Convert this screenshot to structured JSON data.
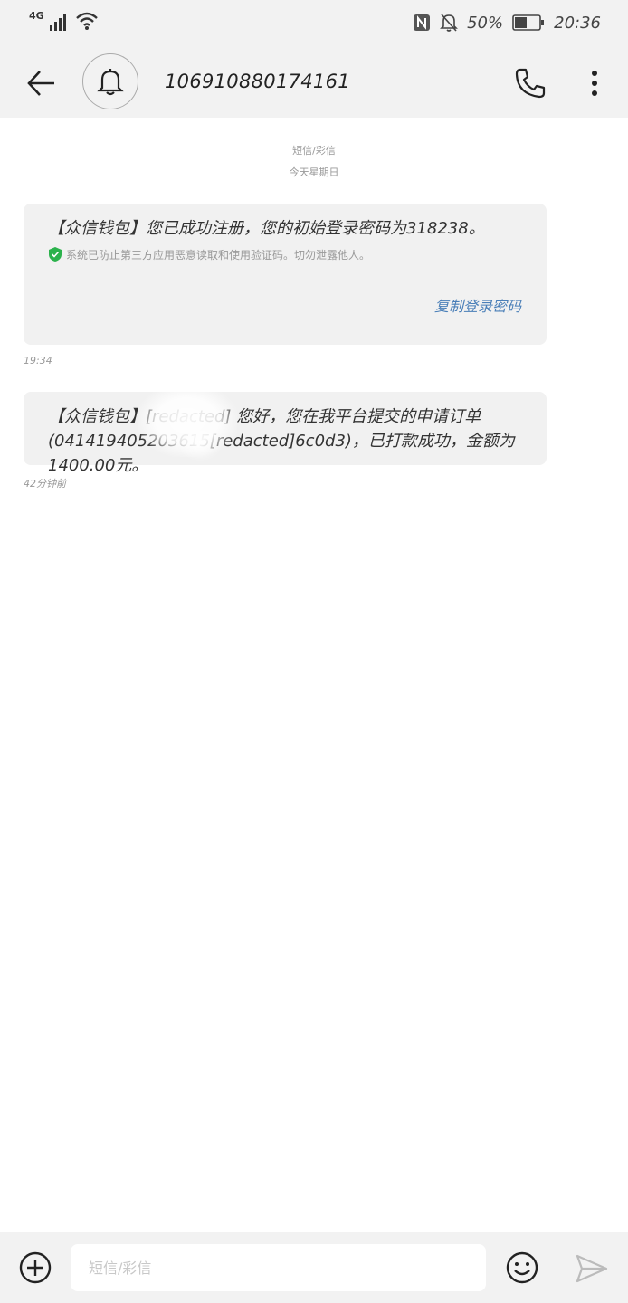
{
  "status_bar": {
    "network": "4G",
    "battery_percent": "50%",
    "battery_level": 0.5,
    "time": "20:36",
    "icons": [
      "signal-icon",
      "wifi-icon",
      "nfc-icon",
      "mute-icon",
      "battery-icon"
    ]
  },
  "toolbar": {
    "contact_number": "106910880174161",
    "icons": [
      "back-arrow-icon",
      "bell-icon",
      "phone-icon",
      "more-vertical-icon"
    ]
  },
  "conversation": {
    "type_label": "短信/彩信",
    "day_label": "今天星期日"
  },
  "messages": [
    {
      "text": "【众信钱包】您已成功注册，您的初始登录密码为318238。",
      "security_note": "系统已防止第三方应用恶意读取和使用验证码。切勿泄露他人。",
      "action_label": "复制登录密码",
      "timestamp": "19:34"
    },
    {
      "text": "【众信钱包】[redacted] 您好，您在我平台提交的申请订单(041419405203615[redacted]6c0d3)，已打款成功，金额为1400.00元。",
      "timestamp": "42分钟前"
    }
  ],
  "composer": {
    "placeholder": "短信/彩信",
    "icons": [
      "add-circle-icon",
      "emoji-icon",
      "send-icon"
    ]
  },
  "colors": {
    "bar_background": "#f2f2f2",
    "bubble_background": "#f1f1f1",
    "link": "#4a7fb8",
    "shield": "#2bb24c"
  }
}
